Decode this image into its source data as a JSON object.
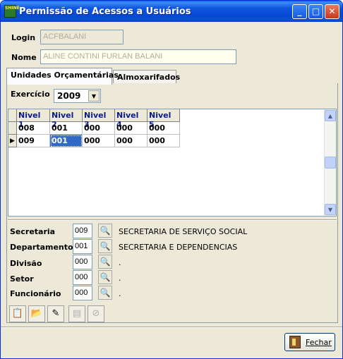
{
  "window": {
    "title": "Permissão de Acessos a Usuários",
    "icon_text": "SHINE",
    "controls": {
      "minimize": "_",
      "maximize": "□",
      "close": "✕"
    }
  },
  "user": {
    "login_label": "Login",
    "login_value": "ACFBALANI",
    "nome_label": "Nome",
    "nome_value": "ALINE CONTINI FURLAN BALANI"
  },
  "tabs": [
    {
      "label": "Unidades Orçamentárias",
      "active": true
    },
    {
      "label": "Almoxarifados",
      "active": false
    }
  ],
  "exercicio": {
    "label": "Exercício",
    "value": "2009"
  },
  "grid": {
    "columns": [
      "Nivel 1",
      "Nivel 2",
      "Nivel 3",
      "Nivel 4",
      "Nivel 5"
    ],
    "rows": [
      [
        "008",
        "001",
        "000",
        "000",
        "000"
      ],
      [
        "009",
        "001",
        "000",
        "000",
        "000"
      ]
    ],
    "current_row_indicator": "▶"
  },
  "details": [
    {
      "label": "Secretaria",
      "code": "009",
      "description": "SECRETARIA DE SERVIÇO SOCIAL"
    },
    {
      "label": "Departamento",
      "code": "001",
      "description": "SECRETARIA E DEPENDENCIAS"
    },
    {
      "label": "Divisão",
      "code": "000",
      "description": "."
    },
    {
      "label": "Setor",
      "code": "000",
      "description": "."
    },
    {
      "label": "Funcionário",
      "code": "000",
      "description": "."
    }
  ],
  "toolbar": [
    {
      "name": "new-record-icon",
      "glyph": "📋",
      "enabled": true
    },
    {
      "name": "open-folder-icon",
      "glyph": "📂",
      "enabled": true
    },
    {
      "name": "edit-icon",
      "glyph": "✎",
      "enabled": true
    },
    {
      "name": "save-icon",
      "glyph": "▤",
      "enabled": false
    },
    {
      "name": "cancel-icon",
      "glyph": "⊘",
      "enabled": false
    }
  ],
  "lookup_glyph": "🔍",
  "scroll": {
    "up": "▲",
    "down": "▼",
    "select_arrow": "▼"
  },
  "footer": {
    "close_label": "Fechar"
  }
}
